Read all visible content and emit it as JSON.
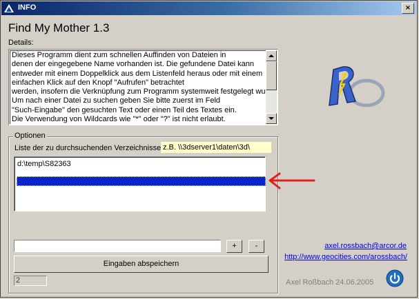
{
  "window": {
    "title": "INFO",
    "close_label": "×"
  },
  "app": {
    "title": "Find My Mother 1.3"
  },
  "details": {
    "label": "Details:",
    "lines": [
      "Dieses Programm dient zum schnellen Auffinden von Dateien in",
      "denen der eingegebene Name vorhanden ist. Die gefundene Datei kann",
      "entweder mit einem Doppelklick aus dem Listenfeld heraus oder mit einem",
      "einfachen Klick auf den Knopf \"Aufrufen\" betrachtet",
      "werden, insofern die Verknüpfung zum Programm systemweit festgelegt wurde.",
      "Um nach einer Datei zu suchen geben Sie bitte zuerst im Feld",
      "\"Such-Eingabe\" den gesuchten Text oder einen Teil des Textes ein.",
      "Die Verwendung von Wildcards wie \"*\" oder \"?\" ist nicht erlaubt."
    ]
  },
  "options": {
    "group_label": "Optionen",
    "dirs_label": "Liste der zu durchsuchenden Verzeichnisse",
    "example_hint": "z.B. \\\\3dserver1\\daten\\3d\\",
    "list_items": [
      "d:\\temp\\S82363",
      ""
    ],
    "path_input_value": "",
    "add_label": "+",
    "remove_label": "-",
    "save_label": "Eingaben abspeichern",
    "count": "2"
  },
  "footer": {
    "email": "axel.rossbach@arcor.de",
    "website": "http://www.geocities.com/arossbach/",
    "author": "Axel Roßbach 24.06.2005"
  },
  "colors": {
    "title_gradient_start": "#0a246a",
    "selection": "#0a24cc",
    "arrow": "#e02020",
    "link": "#0000ee",
    "hint_bg": "#ffffcc",
    "power_button": "#1e6fc0"
  }
}
